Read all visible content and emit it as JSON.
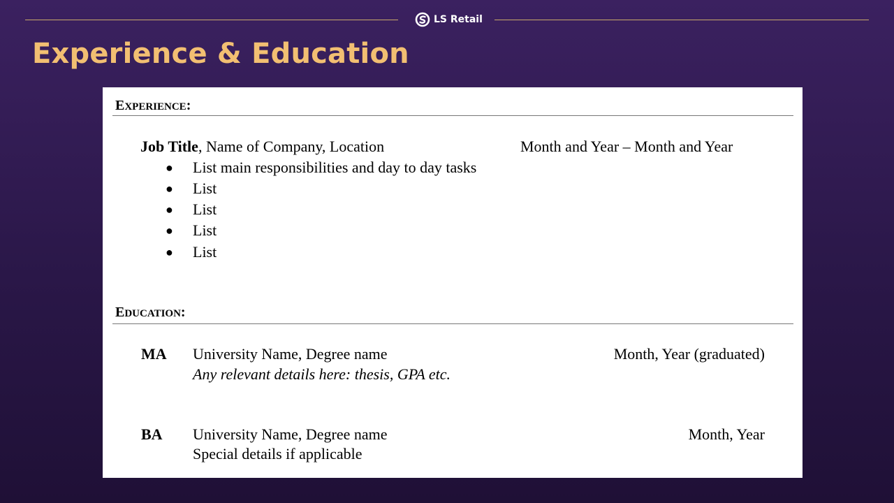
{
  "brand": {
    "name": "LS Retail",
    "icon": "ls-retail-logo-icon"
  },
  "slide": {
    "title": "Experience & Education"
  },
  "colors": {
    "title": "#f2bf72",
    "rule": "#c9a96b",
    "bg_top": "#3b2160",
    "bg_bottom": "#1f1036"
  },
  "experience": {
    "heading_first": "E",
    "heading_rest": "XPERIENCE",
    "heading_colon": ":",
    "job_title": "Job Title",
    "job_rest": ", Name of Company, Location",
    "dates": "Month and Year – Month and Year",
    "bullets": [
      "List main responsibilities and day to day tasks",
      "List",
      "List",
      "List",
      "List"
    ]
  },
  "education": {
    "heading_first": "E",
    "heading_rest": "DUCATION",
    "heading_colon": ":",
    "entries": [
      {
        "degree": "MA",
        "school": "University Name, Degree name",
        "date": "Month, Year (graduated)",
        "details": "Any relevant details here: thesis, GPA etc."
      },
      {
        "degree": "BA",
        "school": "University Name, Degree name",
        "date": "Month, Year",
        "details": "Special details if applicable"
      }
    ]
  }
}
